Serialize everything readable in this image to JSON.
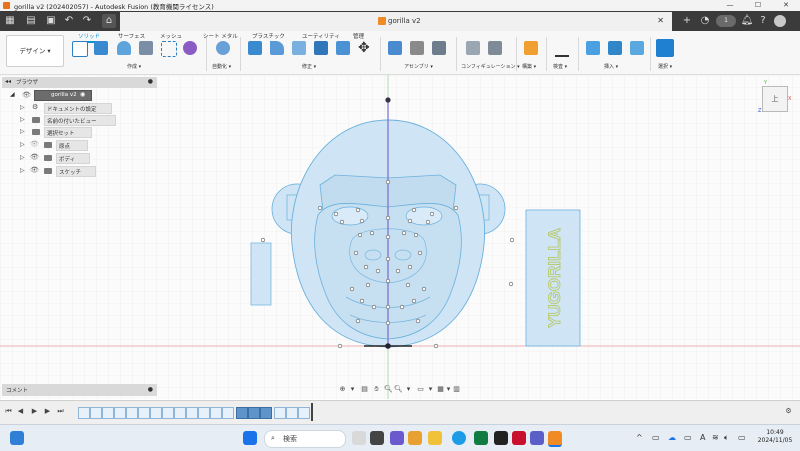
{
  "window": {
    "title": "gorilla v2 (202402057) - Autodesk Fusion (教育機関ライセンス)",
    "minimize": "—",
    "maximize": "☐",
    "close": "✕"
  },
  "document_tab": {
    "label": "gorilla v2",
    "close": "✕",
    "user_count": "1"
  },
  "ribbon": {
    "workspace_label": "デザイン ▾",
    "tabs": [
      {
        "label": "ソリッド",
        "active": true
      },
      {
        "label": "サーフェス",
        "active": false
      },
      {
        "label": "メッシュ",
        "active": false
      },
      {
        "label": "シート メタル",
        "active": false
      },
      {
        "label": "プラスチック",
        "active": false
      },
      {
        "label": "ユーティリティ",
        "active": false
      },
      {
        "label": "管理",
        "active": false
      }
    ],
    "groups": [
      {
        "label": "作成 ▾"
      },
      {
        "label": "自動化 ▾"
      },
      {
        "label": "修正 ▾"
      },
      {
        "label": "アセンブリ ▾"
      },
      {
        "label": "コンフィギュレーション ▾"
      },
      {
        "label": "構築 ▾"
      },
      {
        "label": "検査 ▾"
      },
      {
        "label": "挿入 ▾"
      },
      {
        "label": "選択 ▾"
      }
    ]
  },
  "browser": {
    "title": "ブラウザ",
    "root": "gorilla v2",
    "items": [
      {
        "label": "ドキュメントの設定",
        "icon": "gear-icon"
      },
      {
        "label": "名前の付いたビュー",
        "icon": "folder-icon"
      },
      {
        "label": "選択セット",
        "icon": "folder-icon"
      },
      {
        "label": "原点",
        "icon": "folder-icon"
      },
      {
        "label": "ボディ",
        "icon": "folder-icon"
      },
      {
        "label": "スケッチ",
        "icon": "folder-icon"
      }
    ]
  },
  "comments": {
    "title": "コメント"
  },
  "viewcube": {
    "label": "上",
    "axis_x": "X",
    "axis_y": "Y",
    "axis_z": "Z"
  },
  "model": {
    "text_label": "YUGORILLA"
  },
  "taskbar": {
    "search_placeholder": "検索",
    "clock_time": "10:49",
    "clock_date": "2024/11/05",
    "ime": "A"
  },
  "colors": {
    "accent": "#0696d7",
    "sketch_fill": "#cfe5f5",
    "sketch_line": "#5aa9d6",
    "green_text": "#b8c96a",
    "axis_red": "#e46b6b",
    "axis_green": "#6bc46b",
    "axis_blue": "#5b5bd6"
  }
}
